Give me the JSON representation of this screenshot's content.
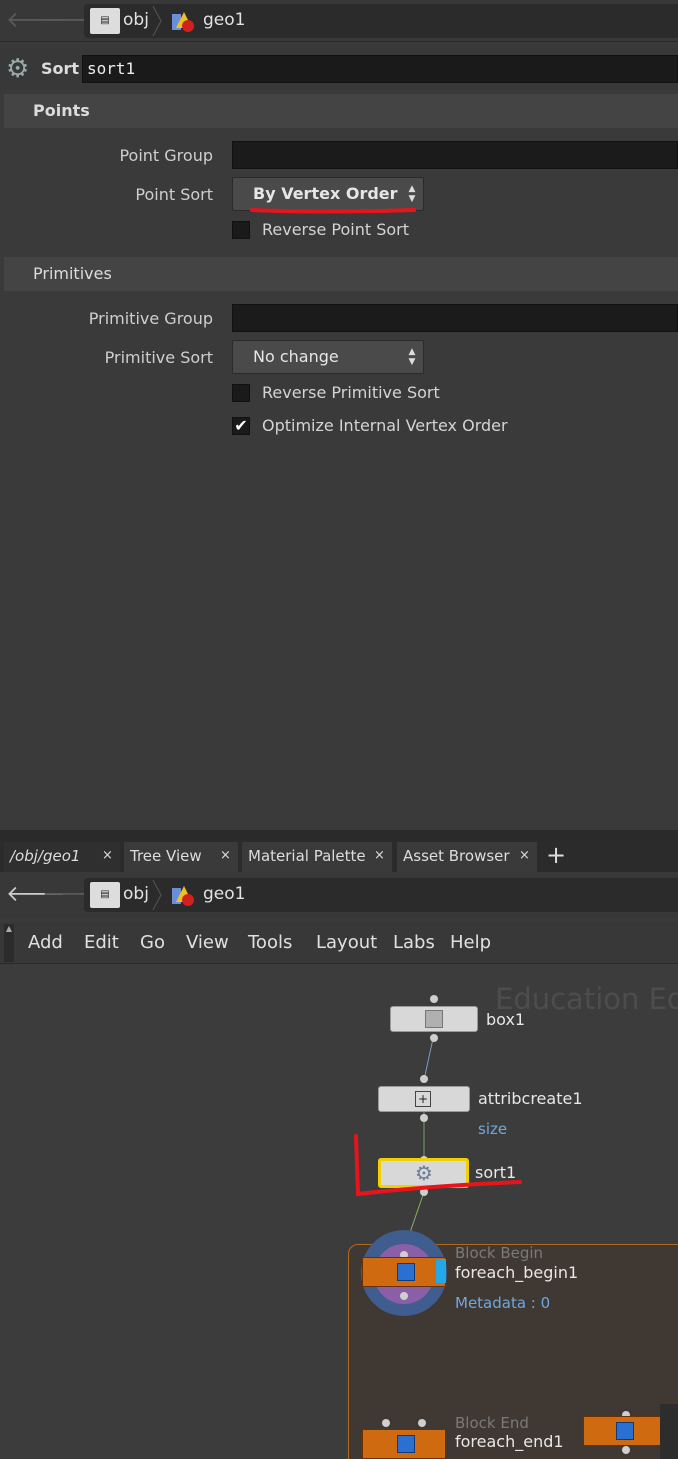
{
  "top_path": {
    "items": [
      "obj",
      "geo1"
    ]
  },
  "node_header": {
    "type_label": "Sort",
    "node_name": "sort1"
  },
  "points_section": {
    "title": "Points",
    "point_group_label": "Point Group",
    "point_group_value": "",
    "point_sort_label": "Point Sort",
    "point_sort_value": "By Vertex Order",
    "reverse_point_sort_label": "Reverse Point Sort",
    "reverse_point_sort_checked": false
  },
  "primitives_section": {
    "title": "Primitives",
    "primitive_group_label": "Primitive Group",
    "primitive_group_value": "",
    "primitive_sort_label": "Primitive Sort",
    "primitive_sort_value": "No change",
    "reverse_primitive_sort_label": "Reverse Primitive Sort",
    "reverse_primitive_sort_checked": false,
    "optimize_label": "Optimize Internal Vertex Order",
    "optimize_checked": true,
    "check_glyph": "✔"
  },
  "tabs": [
    "/obj/geo1",
    "Tree View",
    "Material Palette",
    "Asset Browser"
  ],
  "tab_close_glyph": "×",
  "tab_add_glyph": "+",
  "network_path": {
    "items": [
      "obj",
      "geo1"
    ]
  },
  "menu": [
    "Add",
    "Edit",
    "Go",
    "View",
    "Tools",
    "Layout",
    "Labs",
    "Help"
  ],
  "network": {
    "watermark": "Education Edi",
    "nodes": {
      "box1": "box1",
      "attribcreate1": "attribcreate1",
      "attribcreate1_sub": "size",
      "sort1": "sort1",
      "foreach_begin1_type": "Block Begin",
      "foreach_begin1": "foreach_begin1",
      "foreach_begin1_sub": "Metadata : 0",
      "foreach_end1_type": "Block End",
      "foreach_end1": "foreach_end1"
    }
  },
  "colors": {
    "annotation": "#e8141c",
    "selected": "#f0d000",
    "accent": "#6fa8e0",
    "block": "#d06a10"
  }
}
